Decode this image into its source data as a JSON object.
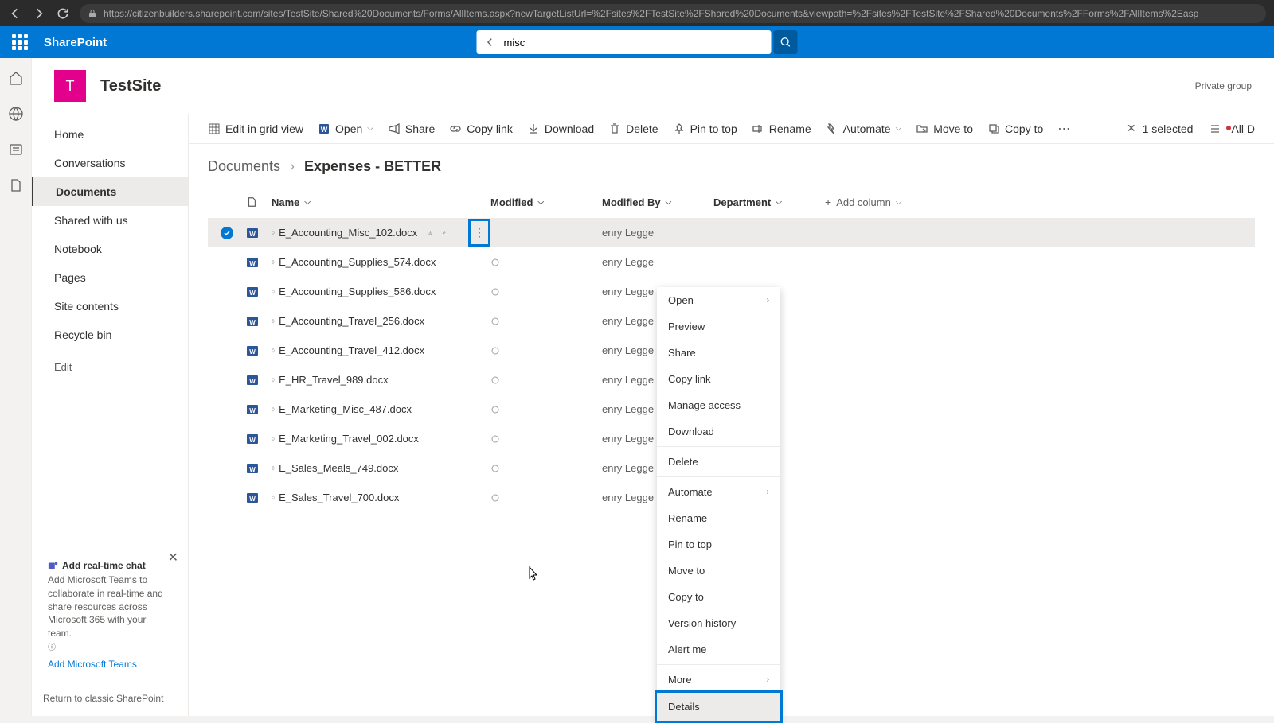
{
  "browser": {
    "url": "https://citizenbuilders.sharepoint.com/sites/TestSite/Shared%20Documents/Forms/AllItems.aspx?newTargetListUrl=%2Fsites%2FTestSite%2FShared%20Documents&viewpath=%2Fsites%2FTestSite%2FShared%20Documents%2FForms%2FAllItems%2Easp"
  },
  "header": {
    "app_name": "SharePoint",
    "search_value": "misc"
  },
  "site": {
    "logo_letter": "T",
    "name": "TestSite",
    "type": "Private group"
  },
  "nav": {
    "items": [
      "Home",
      "Conversations",
      "Documents",
      "Shared with us",
      "Notebook",
      "Pages",
      "Site contents",
      "Recycle bin"
    ],
    "edit": "Edit"
  },
  "chat_promo": {
    "title": "Add real-time chat",
    "body": "Add Microsoft Teams to collaborate in real-time and share resources across Microsoft 365 with your team.",
    "link": "Add Microsoft Teams"
  },
  "classic_link": "Return to classic SharePoint",
  "commands": {
    "edit_grid": "Edit in grid view",
    "open": "Open",
    "share": "Share",
    "copy_link": "Copy link",
    "download": "Download",
    "delete": "Delete",
    "pin": "Pin to top",
    "rename": "Rename",
    "automate": "Automate",
    "move": "Move to",
    "copy": "Copy to",
    "selected": "1 selected",
    "all": "All D"
  },
  "breadcrumb": {
    "parent": "Documents",
    "current": "Expenses - BETTER"
  },
  "columns": {
    "name": "Name",
    "modified": "Modified",
    "modified_by": "Modified By",
    "department": "Department",
    "add": "Add column"
  },
  "files": [
    {
      "name": "E_Accounting_Misc_102.docx",
      "modified_by": "enry Legge",
      "selected": true
    },
    {
      "name": "E_Accounting_Supplies_574.docx",
      "modified_by": "enry Legge"
    },
    {
      "name": "E_Accounting_Supplies_586.docx",
      "modified_by": "enry Legge"
    },
    {
      "name": "E_Accounting_Travel_256.docx",
      "modified_by": "enry Legge"
    },
    {
      "name": "E_Accounting_Travel_412.docx",
      "modified_by": "enry Legge"
    },
    {
      "name": "E_HR_Travel_989.docx",
      "modified_by": "enry Legge"
    },
    {
      "name": "E_Marketing_Misc_487.docx",
      "modified_by": "enry Legge"
    },
    {
      "name": "E_Marketing_Travel_002.docx",
      "modified_by": "enry Legge"
    },
    {
      "name": "E_Sales_Meals_749.docx",
      "modified_by": "enry Legge"
    },
    {
      "name": "E_Sales_Travel_700.docx",
      "modified_by": "enry Legge"
    }
  ],
  "context_menu": {
    "items": [
      "Open",
      "Preview",
      "Share",
      "Copy link",
      "Manage access",
      "Download",
      "Delete",
      "Automate",
      "Rename",
      "Pin to top",
      "Move to",
      "Copy to",
      "Version history",
      "Alert me",
      "More",
      "Details"
    ]
  }
}
